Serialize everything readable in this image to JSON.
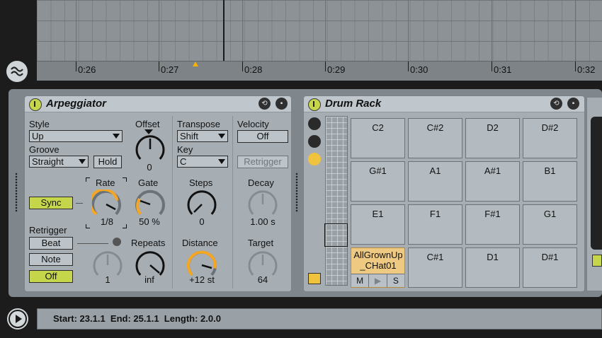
{
  "timeline": {
    "labels": [
      "0:26",
      "0:27",
      "0:28",
      "0:29",
      "0:30",
      "0:31",
      "0:32"
    ]
  },
  "arpeggiator": {
    "title": "Arpeggiator",
    "style_label": "Style",
    "style_value": "Up",
    "groove_label": "Groove",
    "groove_value": "Straight",
    "hold_label": "Hold",
    "offset_label": "Offset",
    "offset_value": "0",
    "sync_label": "Sync",
    "rate_label": "Rate",
    "rate_value": "1/8",
    "gate_label": "Gate",
    "gate_value": "50 %",
    "retrigger_label": "Retrigger",
    "retrigger_options": [
      "Beat",
      "Note",
      "Off"
    ],
    "repeats_label": "Repeats",
    "repeats_value": "inf",
    "repeats_left_value": "1",
    "transpose_label": "Transpose",
    "transpose_value": "Shift",
    "key_label": "Key",
    "key_value": "C",
    "steps_label": "Steps",
    "steps_value": "0",
    "distance_label": "Distance",
    "distance_value": "+12 st",
    "velocity_label": "Velocity",
    "velocity_value": "Off",
    "vel_retrigger_label": "Retrigger",
    "decay_label": "Decay",
    "decay_value": "1.00 s",
    "target_label": "Target",
    "target_value": "64",
    "accent_color": "#f5a623",
    "active_color": "#c6d64a"
  },
  "drum_rack": {
    "title": "Drum Rack",
    "pads": [
      "C2",
      "C#2",
      "D2",
      "D#2",
      "G#1",
      "A1",
      "A#1",
      "B1",
      "E1",
      "F1",
      "F#1",
      "G1",
      "AllGrownUp_CHat01",
      "C#1",
      "D1",
      "D#1"
    ],
    "pad_controls": [
      "M",
      "▶",
      "S"
    ]
  },
  "status": {
    "text": "Start: 23.1.1  End: 25.1.1  Length: 2.0.0"
  }
}
